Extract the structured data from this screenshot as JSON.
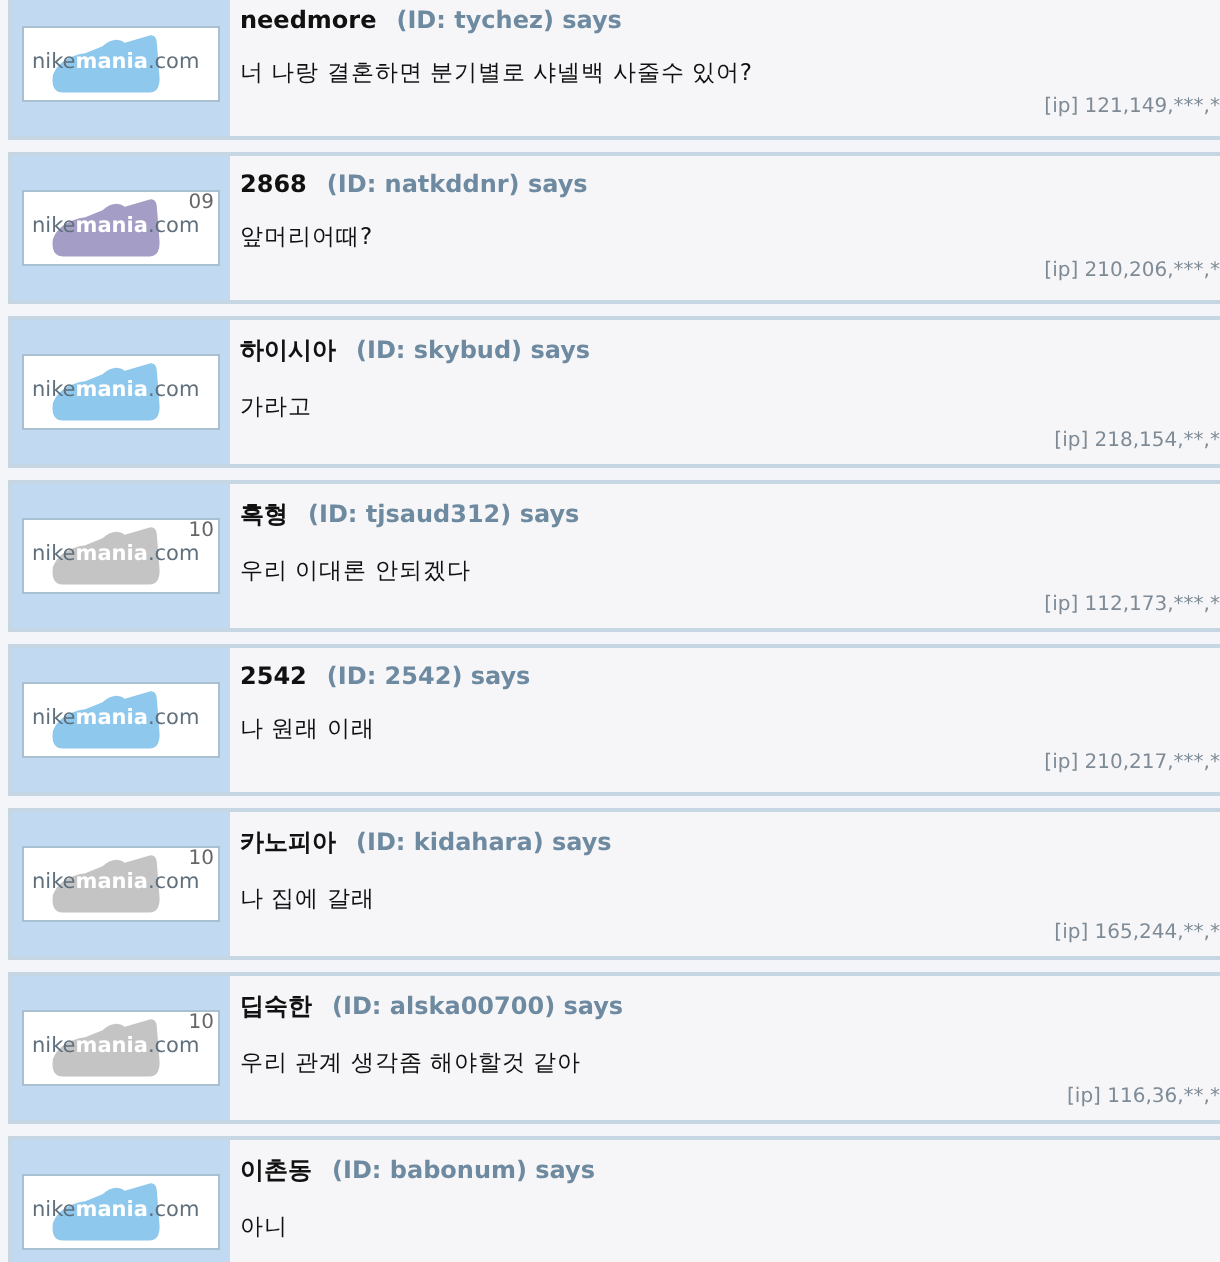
{
  "comments": [
    {
      "name": "needmore",
      "id": "(ID: tychez) says",
      "message": "너 나랑 결혼하면 분기별로 샤넬백 사줄수 있어?",
      "ip": "[ip] 121,149,***,*",
      "badge": {
        "logo": [
          "nike",
          "mania",
          ".com"
        ],
        "color": "#8ec8ec"
      }
    },
    {
      "name": "2868",
      "id": "(ID: natkddnr) says",
      "message": "앞머리어때?",
      "ip": "[ip] 210,206,***,*",
      "badge": {
        "logo": [
          "nike",
          "mania",
          ".com"
        ],
        "color": "#a49ec6",
        "rank": "09"
      }
    },
    {
      "name": "하이시아",
      "id": "(ID: skybud) says",
      "message": "가라고",
      "ip": "[ip] 218,154,**,*",
      "badge": {
        "logo": [
          "nike",
          "mania",
          ".com"
        ],
        "color": "#8ec8ec"
      }
    },
    {
      "name": "흑형",
      "id": "(ID: tjsaud312) says",
      "message": "우리 이대론 안되겠다",
      "ip": "[ip] 112,173,***,*",
      "badge": {
        "logo": [
          "nike",
          "mania",
          ".com"
        ],
        "color": "#c4c4c4",
        "rank": "10"
      }
    },
    {
      "name": "2542",
      "id": "(ID: 2542) says",
      "message": "나 원래 이래",
      "ip": "[ip] 210,217,***,*",
      "badge": {
        "logo": [
          "nike",
          "mania",
          ".com"
        ],
        "color": "#8ec8ec"
      }
    },
    {
      "name": "카노피아",
      "id": "(ID: kidahara) says",
      "message": "나 집에 갈래",
      "ip": "[ip] 165,244,**,*",
      "badge": {
        "logo": [
          "nike",
          "mania",
          ".com"
        ],
        "color": "#c4c4c4",
        "rank": "10"
      }
    },
    {
      "name": "딥숙한",
      "id": "(ID: alska00700) says",
      "message": "우리 관계 생각좀 해야할것 같아",
      "ip": "[ip] 116,36,**,*",
      "badge": {
        "logo": [
          "nike",
          "mania",
          ".com"
        ],
        "color": "#c4c4c4",
        "rank": "10"
      }
    },
    {
      "name": "이촌동",
      "id": "(ID: babonum) says",
      "message": "아니",
      "badge": {
        "logo": [
          "nike",
          "mania",
          ".com"
        ],
        "color": "#8ec8ec"
      }
    }
  ]
}
